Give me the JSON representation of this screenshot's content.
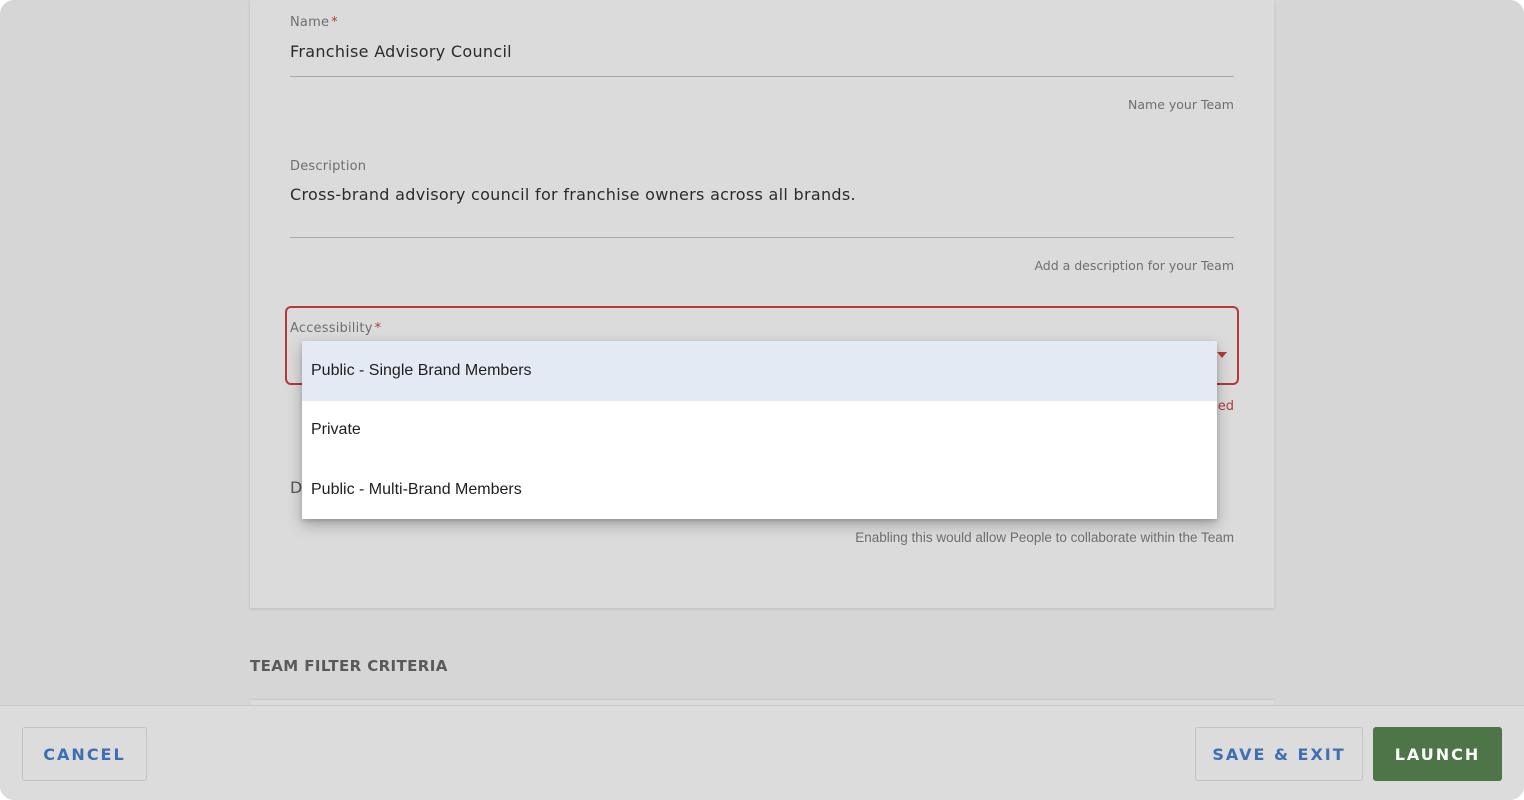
{
  "form": {
    "name": {
      "label": "Name",
      "required_mark": "*",
      "value": "Franchise Advisory Council",
      "helper": "Name your Team"
    },
    "description": {
      "label": "Description",
      "value": "Cross-brand advisory council for franchise owners across all brands.",
      "helper": "Add a description for your Team"
    },
    "accessibility": {
      "label": "Accessibility",
      "required_mark": "*",
      "error_fragment": "ed",
      "options": [
        "Public - Single Brand Members",
        "Private",
        "Public - Multi-Brand Members"
      ],
      "highlighted_option": "Public - Single Brand Members"
    },
    "collaboration": {
      "label_fragment": "D",
      "helper": "Enabling this would allow People to collaborate within the Team"
    }
  },
  "sections": {
    "filter_title": "TEAM FILTER CRITERIA"
  },
  "footer": {
    "cancel_label": "CANCEL",
    "save_label": "SAVE & EXIT",
    "launch_label": "LAUNCH"
  },
  "colors": {
    "error": "#b23a3a",
    "link_blue": "#3e6fb5",
    "launch_green": "#4e7548",
    "option_highlight": "#e3eaf3"
  }
}
